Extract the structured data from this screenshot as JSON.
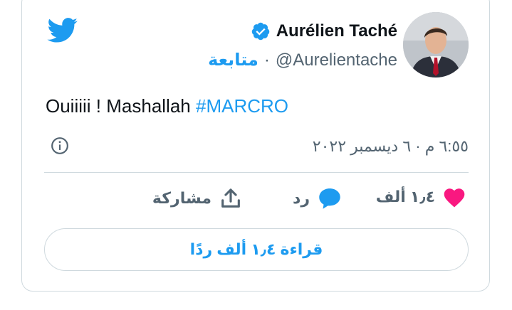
{
  "tweet": {
    "author": {
      "name": "Aurélien Taché",
      "handle": "@Aurelientache",
      "separator": "·",
      "follow_label": "متابعة"
    },
    "text_plain": "Ouiiiii ! Mashallah ",
    "hashtag": "#MARCRO",
    "timestamp": "٦:٥٥ م · ٦ ديسمبر ٢٠٢٢",
    "actions": {
      "like_count": "١٫٤ ألف",
      "reply_label": "رد",
      "share_label": "مشاركة"
    },
    "read_replies_label": "قراءة ١٫٤ ألف ردًا"
  },
  "colors": {
    "accent": "#1d9bf0",
    "like": "#f91880",
    "text": "#0f1419",
    "secondary": "#536471",
    "border": "#cfd9de"
  },
  "icons": [
    "twitter-logo-icon",
    "verified-badge-icon",
    "info-icon",
    "heart-icon",
    "reply-icon",
    "share-icon"
  ]
}
